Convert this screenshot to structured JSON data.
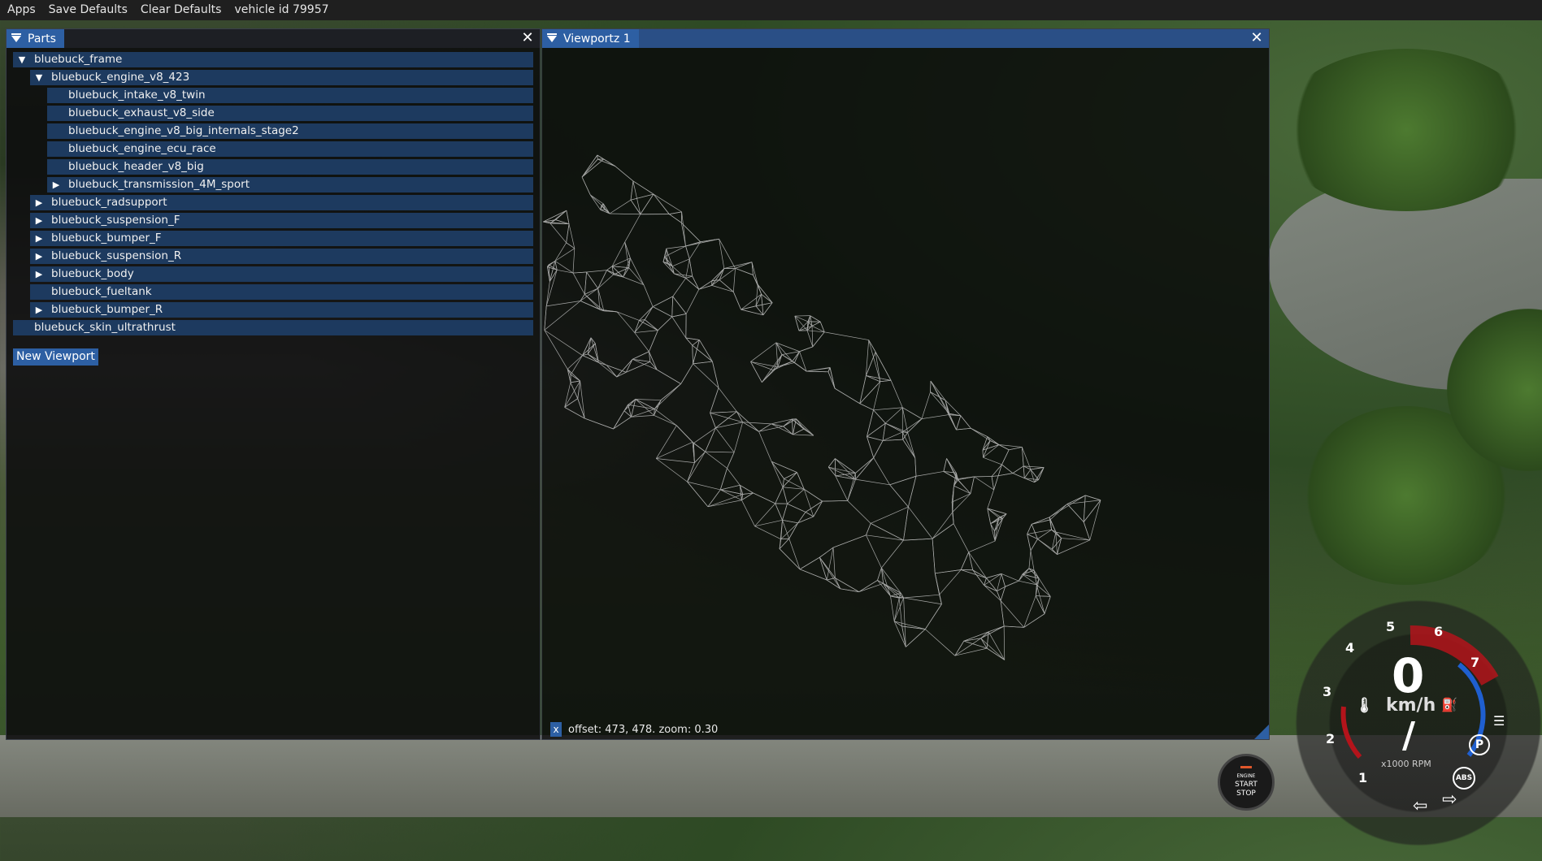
{
  "menubar": {
    "items": [
      "Apps",
      "Save Defaults",
      "Clear Defaults",
      "vehicle id 79957"
    ]
  },
  "parts_window": {
    "title": "Parts",
    "tree": [
      {
        "label": "bluebuck_frame",
        "level": 0,
        "arrow": "down"
      },
      {
        "label": "bluebuck_engine_v8_423",
        "level": 1,
        "arrow": "down"
      },
      {
        "label": "bluebuck_intake_v8_twin",
        "level": 2,
        "arrow": ""
      },
      {
        "label": "bluebuck_exhaust_v8_side",
        "level": 2,
        "arrow": ""
      },
      {
        "label": "bluebuck_engine_v8_big_internals_stage2",
        "level": 2,
        "arrow": ""
      },
      {
        "label": "bluebuck_engine_ecu_race",
        "level": 2,
        "arrow": ""
      },
      {
        "label": "bluebuck_header_v8_big",
        "level": 2,
        "arrow": ""
      },
      {
        "label": "bluebuck_transmission_4M_sport",
        "level": 2,
        "arrow": "right"
      },
      {
        "label": "bluebuck_radsupport",
        "level": 1,
        "arrow": "right"
      },
      {
        "label": "bluebuck_suspension_F",
        "level": 1,
        "arrow": "right"
      },
      {
        "label": "bluebuck_bumper_F",
        "level": 1,
        "arrow": "right"
      },
      {
        "label": "bluebuck_suspension_R",
        "level": 1,
        "arrow": "right"
      },
      {
        "label": "bluebuck_body",
        "level": 1,
        "arrow": "right"
      },
      {
        "label": "bluebuck_fueltank",
        "level": 1,
        "arrow": ""
      },
      {
        "label": "bluebuck_bumper_R",
        "level": 1,
        "arrow": "right"
      },
      {
        "label": "bluebuck_skin_ultrathrust",
        "level": 0,
        "arrow": ""
      }
    ],
    "new_viewport_label": "New Viewport"
  },
  "viewport_window": {
    "title": "Viewportz 1",
    "status_x": "x",
    "status_text": "offset: 473, 478. zoom: 0.30"
  },
  "hud": {
    "speed": "0",
    "speed_unit": "km/h",
    "gear": "/",
    "rpm_unit": "x1000 RPM",
    "rpm_ticks": [
      "1",
      "2",
      "3",
      "4",
      "5",
      "6",
      "7"
    ],
    "engine_button": [
      "ENGINE",
      "START",
      "STOP"
    ],
    "park": "P",
    "abs": "ABS"
  },
  "colors": {
    "accent": "#2d5fa3",
    "tree_row": "#1d3a5f",
    "menubar": "#1f1f1f",
    "redline": "#b3141b",
    "rpm_blue": "#1f5fd0"
  }
}
